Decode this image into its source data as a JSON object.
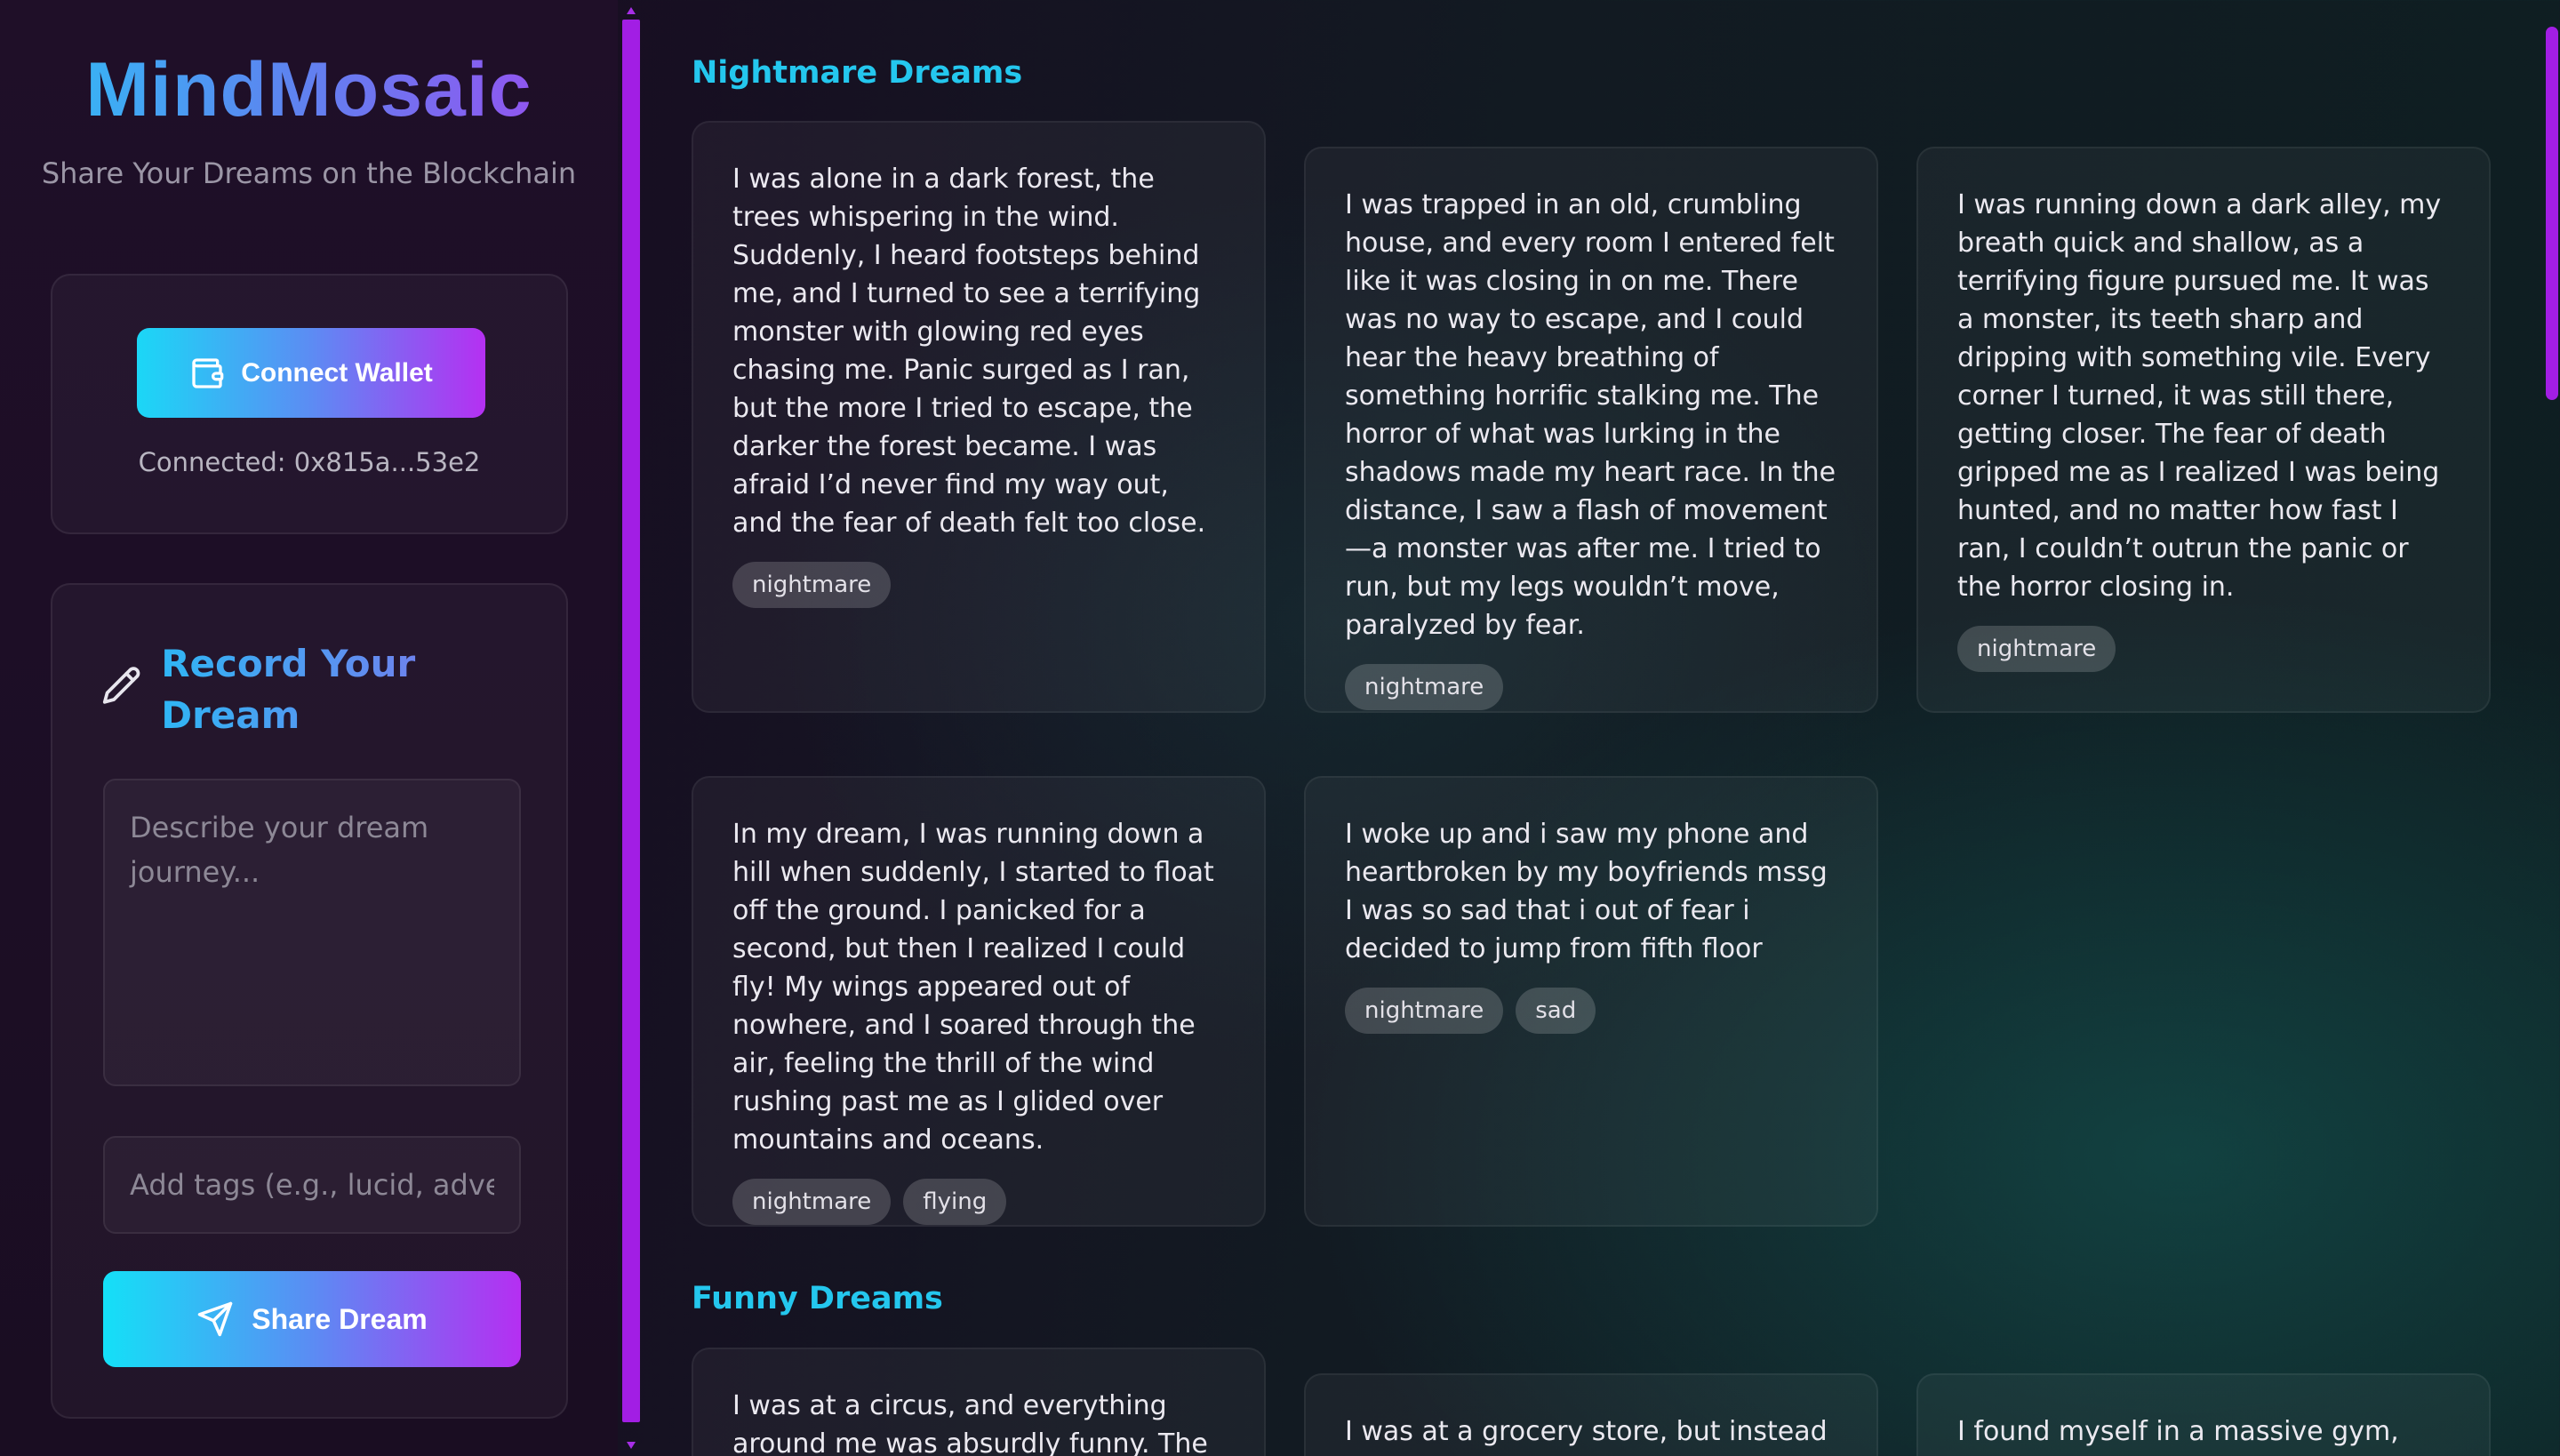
{
  "brand": {
    "name": "MindMosaic",
    "tagline": "Share Your Dreams on the Blockchain"
  },
  "wallet": {
    "button_label": "Connect Wallet",
    "status": "Connected: 0x815a...53e2"
  },
  "record": {
    "title": "Record Your Dream",
    "dream_placeholder": "Describe your dream journey...",
    "tags_placeholder": "Add tags (e.g., lucid, adventure)",
    "submit_label": "Share Dream"
  },
  "sections": [
    {
      "title": "Nightmare Dreams",
      "cards": [
        {
          "text": "I was alone in a dark forest, the trees whispering in the wind. Suddenly, I heard footsteps behind me, and I turned to see a terrifying monster with glowing red eyes chasing me. Panic surged as I ran, but the more I tried to escape, the darker the forest became. I was afraid I’d never find my way out, and the fear of death felt too close.",
          "tags": [
            "nightmare"
          ]
        },
        {
          "text": "I was trapped in an old, crumbling house, and every room I entered felt like it was closing in on me. There was no way to escape, and I could hear the heavy breathing of something horrific stalking me. The horror of what was lurking in the shadows made my heart race. In the distance, I saw a flash of movement—a monster was after me. I tried to run, but my legs wouldn’t move, paralyzed by fear.",
          "tags": [
            "nightmare"
          ]
        },
        {
          "text": "I was running down a dark alley, my breath quick and shallow, as a terrifying figure pursued me. It was a monster, its teeth sharp and dripping with something vile. Every corner I turned, it was still there, getting closer. The fear of death gripped me as I realized I was being hunted, and no matter how fast I ran, I couldn’t outrun the panic or the horror closing in.",
          "tags": [
            "nightmare"
          ]
        },
        {
          "text": "In my dream, I was running down a hill when suddenly, I started to float off the ground. I panicked for a second, but then I realized I could fly! My wings appeared out of nowhere, and I soared through the air, feeling the thrill of the wind rushing past me as I glided over mountains and oceans.",
          "tags": [
            "nightmare",
            "flying"
          ]
        },
        {
          "text": "I woke up and i saw my phone and heartbroken by my boyfriends mssg I was so sad that i out of fear i decided to jump from fifth floor",
          "tags": [
            "nightmare",
            "sad"
          ]
        }
      ]
    },
    {
      "title": "Funny Dreams",
      "cards": [
        {
          "text": "I was at a circus, and everything around me was absurdly funny. The elephants",
          "tags": []
        },
        {
          "text": "I was at a grocery store, but instead of",
          "tags": []
        },
        {
          "text": "I found myself in a massive gym, but",
          "tags": []
        }
      ]
    }
  ],
  "colors": {
    "accent_cyan": "#24c7ee",
    "accent_purple": "#a21ee4"
  }
}
